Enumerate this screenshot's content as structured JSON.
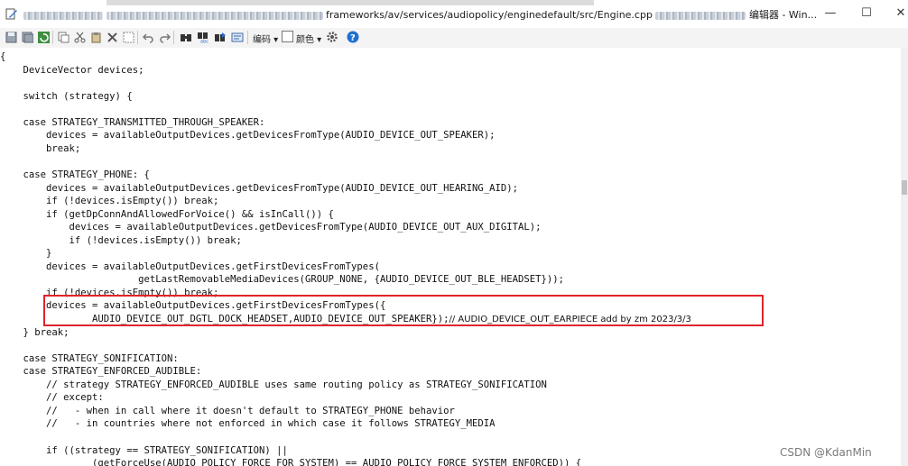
{
  "window": {
    "title_mid": "frameworks/av/services/audiopolicy/enginedefault/src/Engine.cpp",
    "title_app": "编辑器 - Win...",
    "controls": [
      "—",
      "☐",
      "✕"
    ]
  },
  "toolbar": {
    "encoding_label": "编码 ▾",
    "color_label": "颜色 ▾"
  },
  "code_lines": [
    "{",
    "    DeviceVector devices;",
    "",
    "    switch (strategy) {",
    "",
    "    case STRATEGY_TRANSMITTED_THROUGH_SPEAKER:",
    "        devices = availableOutputDevices.getDevicesFromType(AUDIO_DEVICE_OUT_SPEAKER);",
    "        break;",
    "",
    "    case STRATEGY_PHONE: {",
    "        devices = availableOutputDevices.getDevicesFromType(AUDIO_DEVICE_OUT_HEARING_AID);",
    "        if (!devices.isEmpty()) break;",
    "        if (getDpConnAndAllowedForVoice() && isInCall()) {",
    "            devices = availableOutputDevices.getDevicesFromType(AUDIO_DEVICE_OUT_AUX_DIGITAL);",
    "            if (!devices.isEmpty()) break;",
    "        }",
    "        devices = availableOutputDevices.getFirstDevicesFromTypes(",
    "                        getLastRemovableMediaDevices(GROUP_NONE, {AUDIO_DEVICE_OUT_BLE_HEADSET}));",
    "        if (!devices.isEmpty()) break;",
    "        devices = availableOutputDevices.getFirstDevicesFromTypes({",
    "                AUDIO_DEVICE_OUT_DGTL_DOCK_HEADSET,AUDIO_DEVICE_OUT_SPEAKER});",
    "    } break;",
    "",
    "    case STRATEGY_SONIFICATION:",
    "    case STRATEGY_ENFORCED_AUDIBLE:",
    "        // strategy STRATEGY_ENFORCED_AUDIBLE uses same routing policy as STRATEGY_SONIFICATION",
    "        // except:",
    "        //   - when in call where it doesn't default to STRATEGY_PHONE behavior",
    "        //   - in countries where not enforced in which case it follows STRATEGY_MEDIA",
    "",
    "        if ((strategy == STRATEGY_SONIFICATION) ||",
    "                (getForceUse(AUDIO_POLICY_FORCE_FOR_SYSTEM) == AUDIO_POLICY_FORCE_SYSTEM_ENFORCED)) {"
  ],
  "annotation_tail": "// AUDIO_DEVICE_OUT_EARPIECE add by zm 2023/3/3",
  "watermark": "CSDN @KdanMin",
  "colors": {
    "highlight_box": "#e0242a"
  }
}
